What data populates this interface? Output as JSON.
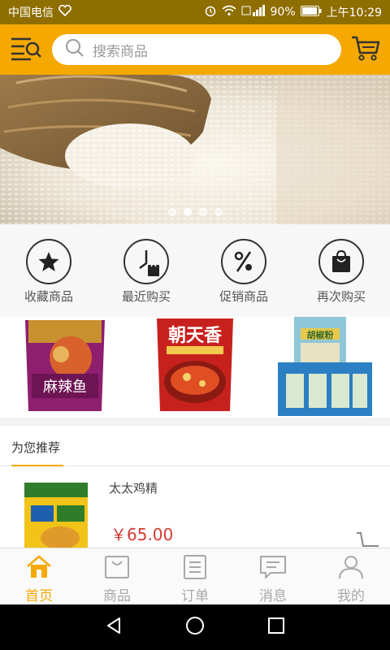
{
  "status_bar": {
    "carrier": "中国电信",
    "battery": "90%",
    "time": "上午10:29"
  },
  "header": {
    "search_placeholder": "搜索商品"
  },
  "banner": {
    "dots_count": 4,
    "active_dot": 2
  },
  "quick_actions": [
    {
      "label": "收藏商品",
      "icon": "star-icon"
    },
    {
      "label": "最近购买",
      "icon": "clock-bag-icon"
    },
    {
      "label": "促销商品",
      "icon": "percent-icon"
    },
    {
      "label": "再次购买",
      "icon": "bag-icon"
    }
  ],
  "products_strip": [
    {
      "name": "麻辣鱼",
      "icon": "product-package"
    },
    {
      "name": "朝天香",
      "icon": "product-package"
    },
    {
      "name": "胡椒粉",
      "icon": "product-box"
    }
  ],
  "recommend": {
    "tab_label": "为您推荐",
    "item": {
      "name": "太太鸡精",
      "price": "￥65.00"
    }
  },
  "tabbar": [
    {
      "label": "首页",
      "icon": "home-icon",
      "active": true
    },
    {
      "label": "商品",
      "icon": "bag-icon",
      "active": false
    },
    {
      "label": "订单",
      "icon": "order-icon",
      "active": false
    },
    {
      "label": "消息",
      "icon": "message-icon",
      "active": false
    },
    {
      "label": "我的",
      "icon": "user-icon",
      "active": false
    }
  ],
  "colors": {
    "accent": "#f5a800",
    "status_bar": "#8f6e00",
    "price": "#d43c33"
  }
}
